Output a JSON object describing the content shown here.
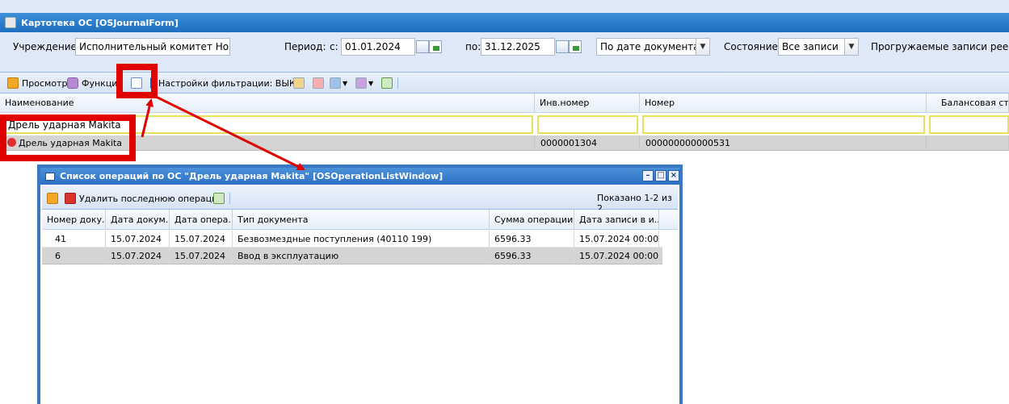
{
  "main_window": {
    "title": "Картотека ОС [OSJournalForm]"
  },
  "filters": {
    "institution_label": "Учреждение:",
    "institution_value": "Исполнительный комитет Новопс",
    "period_label": "Период:",
    "from_label": "с:",
    "from_value": "01.01.2024",
    "to_label": "по:",
    "to_value": "31.12.2025",
    "date_mode_value": "По дате документа",
    "state_label": "Состояние:",
    "state_value": "Все записи",
    "loaded_records_label": "Прогружаемые записи реестра"
  },
  "toolbar": {
    "view_label": "Просмотр",
    "functions_label": "Функции",
    "filter_settings_label": "Настройки фильтрации: ВЫКЛ"
  },
  "grid": {
    "columns": [
      "Наименование",
      "Инв.номер",
      "Номер",
      "Балансовая стои"
    ],
    "filter_name_value": "Дрель ударная Makita",
    "row": {
      "name": "Дрель ударная Makita",
      "inv_number": "0000001304",
      "number": "000000000000531"
    }
  },
  "dialog": {
    "title": "Список операций по ОС \"Дрель ударная Makita\" [OSOperationListWindow]",
    "delete_last_label": "Удалить последнюю операцию",
    "shown_label": "Показано 1-2 из 2",
    "columns": [
      "Номер доку...",
      "Дата докум...",
      "Дата опера...",
      "Тип документа",
      "Сумма операции",
      "Дата записи в и..."
    ],
    "rows": [
      [
        "41",
        "15.07.2024",
        "15.07.2024",
        "Безвозмездные поступления (40110 199)",
        "6596.33",
        "15.07.2024 00:00..."
      ],
      [
        "6",
        "15.07.2024",
        "15.07.2024",
        "Ввод в эксплуатацию",
        "6596.33",
        "15.07.2024 00:00..."
      ]
    ]
  },
  "colors": {
    "title_bar": "#2c70c2",
    "annotation_red": "#e00000",
    "filter_highlight": "#e8e25a",
    "selected_row": "#d4d4d4"
  }
}
